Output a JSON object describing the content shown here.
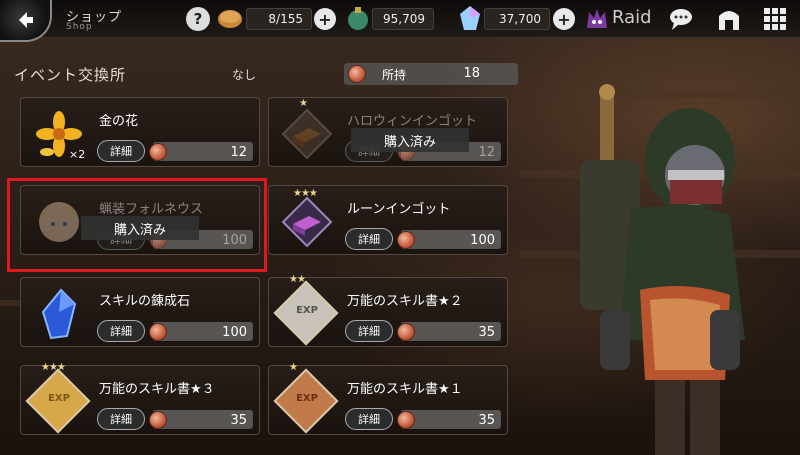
{
  "header": {
    "title": "ショップ",
    "subtitle": "Shop",
    "help": "?",
    "resources": [
      {
        "name": "stamina",
        "icon": "bread-icon",
        "value": "8/155"
      },
      {
        "name": "gold",
        "icon": "money-bag-icon",
        "value": "95,709"
      },
      {
        "name": "gems",
        "icon": "crystal-icon",
        "value": "37,700"
      }
    ],
    "plus": "+",
    "raid": "Raid"
  },
  "exchange": {
    "title": "イベント交換所",
    "condition": "なし",
    "owned_label": "所持",
    "owned_value": "18"
  },
  "common": {
    "detail_label": "詳細",
    "purchased_label": "購入済み"
  },
  "items": [
    {
      "name": "金の花",
      "cost": "12",
      "qty": "×2",
      "sold_out": false,
      "icon": "golden-flower-icon"
    },
    {
      "name": "ハロウィンインゴット",
      "cost": "12",
      "sold_out": true,
      "icon": "bronze-ingot-icon",
      "stars": "★"
    },
    {
      "name": "蝋装フォルネウス",
      "cost": "100",
      "sold_out": true,
      "icon": "fairy-portrait-icon"
    },
    {
      "name": "ルーンインゴット",
      "cost": "100",
      "sold_out": false,
      "icon": "rune-ingot-icon",
      "stars": "★★★"
    },
    {
      "name": "スキルの錬成石",
      "cost": "100",
      "sold_out": false,
      "icon": "blue-crystal-icon"
    },
    {
      "name": "万能のスキル書★２",
      "cost": "35",
      "sold_out": false,
      "icon": "skill-book-exp-icon",
      "stars": "★★",
      "exp": "EXP"
    },
    {
      "name": "万能のスキル書★３",
      "cost": "35",
      "sold_out": false,
      "icon": "skill-book-exp-icon",
      "stars": "★★★",
      "exp": "EXP"
    },
    {
      "name": "万能のスキル書★１",
      "cost": "35",
      "sold_out": false,
      "icon": "skill-book-exp-icon",
      "stars": "★",
      "exp": "EXP"
    }
  ],
  "colors": {
    "highlight": "#e0191f",
    "coin": "#c45a3a",
    "gold_badge": "#d6a84a",
    "silver_badge": "#c8c2b8",
    "bronze_badge": "#c27a4a"
  }
}
